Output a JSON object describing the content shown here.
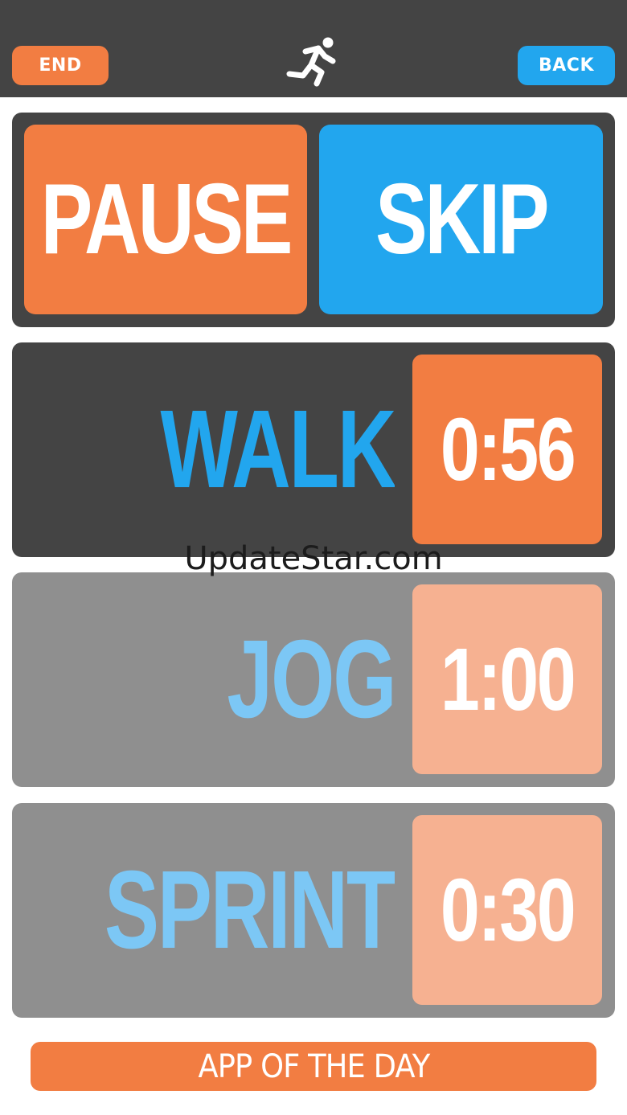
{
  "header": {
    "end_label": "END",
    "back_label": "BACK",
    "logo_icon": "runner-icon"
  },
  "controls": {
    "pause_label": "PAUSE",
    "skip_label": "SKIP"
  },
  "intervals": [
    {
      "name": "WALK",
      "time": "0:56",
      "state": "active"
    },
    {
      "name": "JOG",
      "time": "1:00",
      "state": "pending"
    },
    {
      "name": "SPRINT",
      "time": "0:30",
      "state": "pending"
    }
  ],
  "footer": {
    "app_of_the_day_label": "APP OF THE DAY"
  },
  "watermark": "UpdateStar.com",
  "colors": {
    "orange": "#f27d42",
    "blue": "#22a6ee",
    "dark_gray": "#444444",
    "gray": "#8f8f8f",
    "light_orange": "#f6b191",
    "light_blue": "#7cc7f5"
  }
}
